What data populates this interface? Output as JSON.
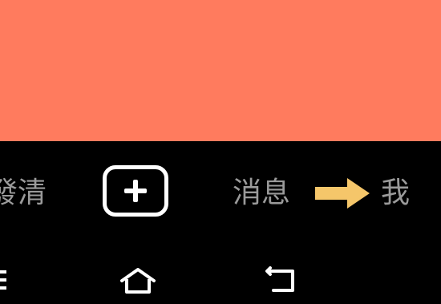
{
  "content": {
    "background_color": "#FF7B5E"
  },
  "tab_bar": {
    "left_tab_label": "發清",
    "add_icon": "plus-square-icon",
    "messages_label": "消息",
    "arrow_icon": "arrow-right-icon",
    "arrow_color": "#F5C66A",
    "me_label": "我",
    "label_color": "#9A9A9A"
  },
  "system_nav": {
    "icons": [
      "menu-icon",
      "home-icon",
      "back-icon"
    ]
  }
}
